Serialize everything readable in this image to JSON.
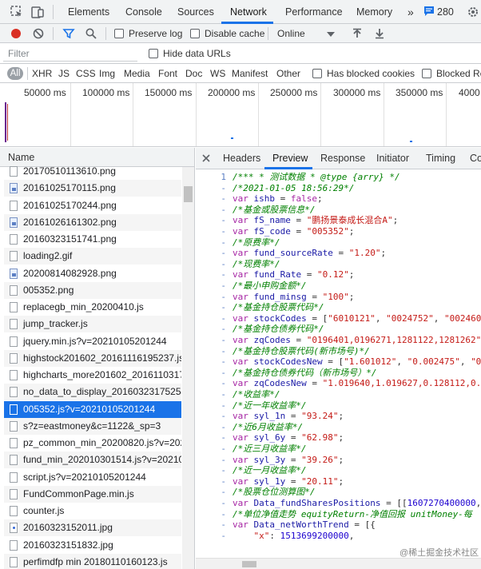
{
  "top_tabs": [
    "Elements",
    "Console",
    "Sources",
    "Network",
    "Performance",
    "Memory"
  ],
  "more_tabs_glyph": "»",
  "message_count": "280",
  "toolbar": {
    "preserve_log": "Preserve log",
    "disable_cache": "Disable cache",
    "throttle": "Online"
  },
  "filter": {
    "placeholder": "Filter",
    "hide_data_urls": "Hide data URLs"
  },
  "types": [
    "All",
    "XHR",
    "JS",
    "CSS",
    "Img",
    "Media",
    "Font",
    "Doc",
    "WS",
    "Manifest",
    "Other"
  ],
  "has_blocked_cookies": "Has blocked cookies",
  "blocked_requests": "Blocked Re",
  "timeline": {
    "ticks": [
      "50000 ms",
      "100000 ms",
      "150000 ms",
      "200000 ms",
      "250000 ms",
      "300000 ms",
      "350000 ms",
      "4000"
    ]
  },
  "request_list": {
    "column_header": "Name",
    "rows": [
      {
        "name": "20170510113610.png",
        "icon": "file-icon"
      },
      {
        "name": "20161025170115.png",
        "icon": "image-icon"
      },
      {
        "name": "20161025170244.png",
        "icon": "file-icon"
      },
      {
        "name": "20161026161302.png",
        "icon": "image-icon"
      },
      {
        "name": "20160323151741.png",
        "icon": "file-icon"
      },
      {
        "name": "loading2.gif",
        "icon": "file-icon"
      },
      {
        "name": "20200814082928.png",
        "icon": "image-icon"
      },
      {
        "name": "005352.png",
        "icon": "file-icon"
      },
      {
        "name": "replacegb_min_20200410.js",
        "icon": "file-icon"
      },
      {
        "name": "jump_tracker.js",
        "icon": "file-icon"
      },
      {
        "name": "jquery.min.js?v=20210105201244",
        "icon": "file-icon"
      },
      {
        "name": "highstock201602_20161116195237.js",
        "icon": "file-icon"
      },
      {
        "name": "highcharts_more201602_20161103171",
        "icon": "file-icon"
      },
      {
        "name": "no_data_to_display_20160323175254.",
        "icon": "file-icon"
      },
      {
        "name": "005352.js?v=20210105201244",
        "icon": "file-icon"
      },
      {
        "name": "s?z=eastmoney&c=1122&_sp=3",
        "icon": "file-icon"
      },
      {
        "name": "pz_common_min_20200820.js?v=202",
        "icon": "file-icon"
      },
      {
        "name": "fund_min_202010301514.js?v=202101",
        "icon": "file-icon"
      },
      {
        "name": "script.js?v=20210105201244",
        "icon": "file-icon"
      },
      {
        "name": "FundCommonPage.min.js",
        "icon": "file-icon"
      },
      {
        "name": "counter.js",
        "icon": "file-icon"
      },
      {
        "name": "20160323152011.jpg",
        "icon": "dot-icon"
      },
      {
        "name": "20160323151832.jpg",
        "icon": "file-icon"
      },
      {
        "name": "perfimdfp min 20180110160123.js",
        "icon": "file-icon"
      }
    ],
    "selected_index": 14
  },
  "detail_tabs": [
    "Headers",
    "Preview",
    "Response",
    "Initiator",
    "Timing",
    "Co"
  ],
  "code_lines": [
    {
      "gutter": "1",
      "tokens": [
        [
          "c-com",
          "/*** * 测试数据 * @type {arry} */"
        ]
      ]
    },
    {
      "gutter": "-",
      "tokens": [
        [
          "c-com",
          "/*2021-01-05 18:56:29*/"
        ]
      ]
    },
    {
      "gutter": "-",
      "tokens": [
        [
          "c-kw",
          "var "
        ],
        [
          "c-id",
          "ishb"
        ],
        [
          "c-pun",
          " = "
        ],
        [
          "c-kw",
          "false"
        ],
        [
          "c-pun",
          ";"
        ]
      ]
    },
    {
      "gutter": "-",
      "tokens": [
        [
          "c-com",
          "/*基金或股票信息*/"
        ]
      ]
    },
    {
      "gutter": "-",
      "tokens": [
        [
          "c-kw",
          "var "
        ],
        [
          "c-id",
          "fS_name"
        ],
        [
          "c-pun",
          " = "
        ],
        [
          "c-str",
          "\"鹏扬景泰成长混合A\""
        ],
        [
          "c-pun",
          ";"
        ]
      ]
    },
    {
      "gutter": "-",
      "tokens": [
        [
          "c-kw",
          "var "
        ],
        [
          "c-id",
          "fS_code"
        ],
        [
          "c-pun",
          " = "
        ],
        [
          "c-str",
          "\"005352\""
        ],
        [
          "c-pun",
          ";"
        ]
      ]
    },
    {
      "gutter": "-",
      "tokens": [
        [
          "c-com",
          "/*原费率*/"
        ]
      ]
    },
    {
      "gutter": "-",
      "tokens": [
        [
          "c-kw",
          "var "
        ],
        [
          "c-id",
          "fund_sourceRate"
        ],
        [
          "c-pun",
          " = "
        ],
        [
          "c-str",
          "\"1.20\""
        ],
        [
          "c-pun",
          ";"
        ]
      ]
    },
    {
      "gutter": "-",
      "tokens": [
        [
          "c-com",
          "/*现费率*/"
        ]
      ]
    },
    {
      "gutter": "-",
      "tokens": [
        [
          "c-kw",
          "var "
        ],
        [
          "c-id",
          "fund_Rate"
        ],
        [
          "c-pun",
          " = "
        ],
        [
          "c-str",
          "\"0.12\""
        ],
        [
          "c-pun",
          ";"
        ]
      ]
    },
    {
      "gutter": "-",
      "tokens": [
        [
          "c-com",
          "/*最小申购金额*/"
        ]
      ]
    },
    {
      "gutter": "-",
      "tokens": [
        [
          "c-kw",
          "var "
        ],
        [
          "c-id",
          "fund_minsg"
        ],
        [
          "c-pun",
          " = "
        ],
        [
          "c-str",
          "\"100\""
        ],
        [
          "c-pun",
          ";"
        ]
      ]
    },
    {
      "gutter": "-",
      "tokens": [
        [
          "c-com",
          "/*基金持仓股票代码*/"
        ]
      ]
    },
    {
      "gutter": "-",
      "tokens": [
        [
          "c-kw",
          "var "
        ],
        [
          "c-id",
          "stockCodes"
        ],
        [
          "c-pun",
          " = ["
        ],
        [
          "c-str",
          "\"6010121\""
        ],
        [
          "c-pun",
          ", "
        ],
        [
          "c-str",
          "\"0024752\""
        ],
        [
          "c-pun",
          ", "
        ],
        [
          "c-str",
          "\"002460"
        ]
      ]
    },
    {
      "gutter": "-",
      "tokens": [
        [
          "c-com",
          "/*基金持仓债券代码*/"
        ]
      ]
    },
    {
      "gutter": "-",
      "tokens": [
        [
          "c-kw",
          "var "
        ],
        [
          "c-id",
          "zqCodes"
        ],
        [
          "c-pun",
          " = "
        ],
        [
          "c-str",
          "\"0196401,0196271,1281122,1281262\""
        ]
      ]
    },
    {
      "gutter": "-",
      "tokens": [
        [
          "c-com",
          "/*基金持仓股票代码(新市场号)*/"
        ]
      ]
    },
    {
      "gutter": "-",
      "tokens": [
        [
          "c-kw",
          "var "
        ],
        [
          "c-id",
          "stockCodesNew"
        ],
        [
          "c-pun",
          " = ["
        ],
        [
          "c-str",
          "\"1.601012\""
        ],
        [
          "c-pun",
          ", "
        ],
        [
          "c-str",
          "\"0.002475\""
        ],
        [
          "c-pun",
          ", "
        ],
        [
          "c-str",
          "\"0"
        ]
      ]
    },
    {
      "gutter": "-",
      "tokens": [
        [
          "c-com",
          "/*基金持仓债券代码（新市场号）*/"
        ]
      ]
    },
    {
      "gutter": "-",
      "tokens": [
        [
          "c-kw",
          "var "
        ],
        [
          "c-id",
          "zqCodesNew"
        ],
        [
          "c-pun",
          " = "
        ],
        [
          "c-str",
          "\"1.019640,1.019627,0.128112,0."
        ]
      ]
    },
    {
      "gutter": "-",
      "tokens": [
        [
          "c-com",
          "/*收益率*/"
        ]
      ]
    },
    {
      "gutter": "-",
      "tokens": [
        [
          "c-com",
          "/*近一年收益率*/"
        ]
      ]
    },
    {
      "gutter": "-",
      "tokens": [
        [
          "c-kw",
          "var "
        ],
        [
          "c-id",
          "syl_1n"
        ],
        [
          "c-pun",
          " = "
        ],
        [
          "c-str",
          "\"93.24\""
        ],
        [
          "c-pun",
          ";"
        ]
      ]
    },
    {
      "gutter": "-",
      "tokens": [
        [
          "c-com",
          "/*近6月收益率*/"
        ]
      ]
    },
    {
      "gutter": "-",
      "tokens": [
        [
          "c-kw",
          "var "
        ],
        [
          "c-id",
          "syl_6y"
        ],
        [
          "c-pun",
          " = "
        ],
        [
          "c-str",
          "\"62.98\""
        ],
        [
          "c-pun",
          ";"
        ]
      ]
    },
    {
      "gutter": "-",
      "tokens": [
        [
          "c-com",
          "/*近三月收益率*/"
        ]
      ]
    },
    {
      "gutter": "-",
      "tokens": [
        [
          "c-kw",
          "var "
        ],
        [
          "c-id",
          "syl_3y"
        ],
        [
          "c-pun",
          " = "
        ],
        [
          "c-str",
          "\"39.26\""
        ],
        [
          "c-pun",
          ";"
        ]
      ]
    },
    {
      "gutter": "-",
      "tokens": [
        [
          "c-com",
          "/*近一月收益率*/"
        ]
      ]
    },
    {
      "gutter": "-",
      "tokens": [
        [
          "c-kw",
          "var "
        ],
        [
          "c-id",
          "syl_1y"
        ],
        [
          "c-pun",
          " = "
        ],
        [
          "c-str",
          "\"20.11\""
        ],
        [
          "c-pun",
          ";"
        ]
      ]
    },
    {
      "gutter": "-",
      "tokens": [
        [
          "c-com",
          "/*股票仓位测算图*/"
        ]
      ]
    },
    {
      "gutter": "-",
      "tokens": [
        [
          "c-kw",
          "var "
        ],
        [
          "c-id",
          "Data_fundSharesPositions"
        ],
        [
          "c-pun",
          " = [["
        ],
        [
          "c-num",
          "1607270400000"
        ],
        [
          "c-pun",
          ","
        ]
      ]
    },
    {
      "gutter": "-",
      "tokens": [
        [
          "c-com",
          "/*单位净值走势 equityReturn-净值回报 unitMoney-每"
        ]
      ]
    },
    {
      "gutter": "-",
      "tokens": [
        [
          "c-kw",
          "var "
        ],
        [
          "c-id",
          "Data_netWorthTrend"
        ],
        [
          "c-pun",
          " = [{"
        ]
      ]
    },
    {
      "gutter": "-",
      "tokens": [
        [
          "c-pun",
          "    "
        ],
        [
          "c-str",
          "\"x\""
        ],
        [
          "c-pun",
          ": "
        ],
        [
          "c-num",
          "1513699200000"
        ],
        [
          "c-pun",
          ","
        ]
      ]
    }
  ],
  "watermark": "@稀土掘金技术社区"
}
